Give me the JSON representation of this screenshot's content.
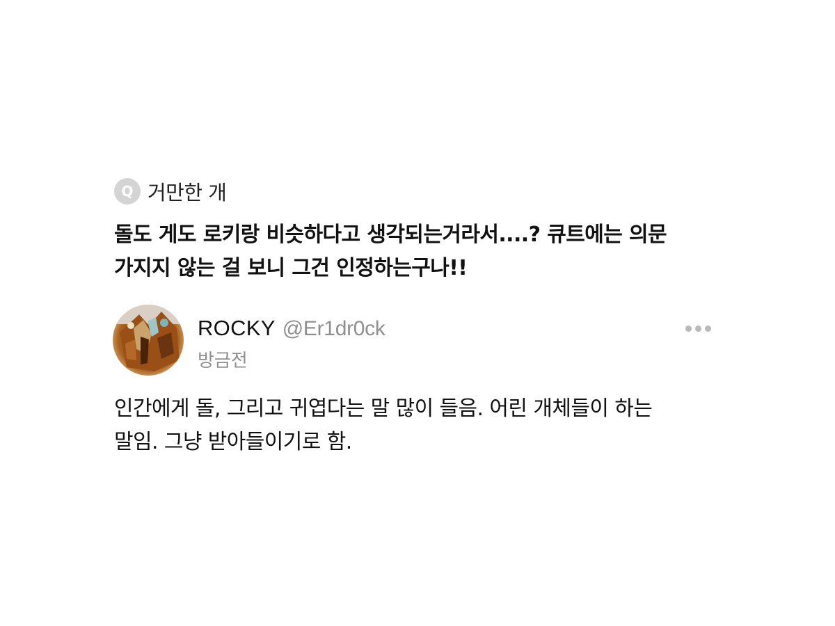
{
  "question": {
    "badge": "Q",
    "asker": "거만한 개",
    "text_lines": [
      "돌도 게도 로키랑 비슷하다고 생각되는거라서....? 큐트에는 의문",
      "가지지 않는 걸 보니 그건 인정하는구나!!"
    ]
  },
  "answer": {
    "display_name": "ROCKY",
    "handle": "@Er1dr0ck",
    "timestamp": "방금전",
    "text_lines": [
      "인간에게 돌, 그리고 귀엽다는 말 많이 들음. 어린 개체들이 하는",
      "말임. 그냥 받아들이기로 함."
    ]
  },
  "icons": {
    "more": "more-horizontal-icon",
    "avatar": "avatar-photo"
  },
  "colors": {
    "background": "#ffffff",
    "text": "#111111",
    "muted": "#8f8f8f",
    "badge": "#d4d4d4"
  }
}
